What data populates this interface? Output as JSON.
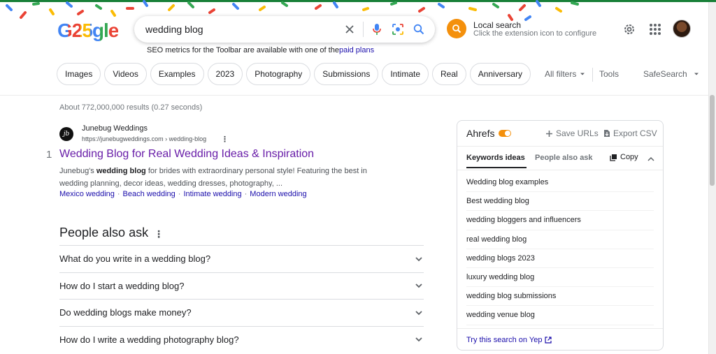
{
  "header": {
    "logo_text": "G25gle",
    "search_query": "wedding blog",
    "local_search": {
      "title": "Local search",
      "subtitle": "Click the extension icon to configure"
    },
    "seo_note": {
      "text": "SEO metrics for the Toolbar are available with one of the",
      "link": "paid plans"
    }
  },
  "chips": [
    "Images",
    "Videos",
    "Examples",
    "2023",
    "Photography",
    "Submissions",
    "Intimate",
    "Real",
    "Anniversary"
  ],
  "tools": {
    "all_filters": "All filters",
    "tools": "Tools",
    "safesearch": "SafeSearch"
  },
  "results": {
    "stats": "About 772,000,000 results (0.27 seconds)",
    "items": [
      {
        "rank": "1",
        "favicon_text": "jb",
        "site_name": "Junebug Weddings",
        "url": "https://junebugweddings.com › wedding-blog",
        "title": "Wedding Blog for Real Wedding Ideas & Inspiration",
        "snippet_pre": "Junebug's ",
        "snippet_bold": "wedding blog",
        "snippet_post": " for brides with extraordinary personal style! Featuring the best in wedding planning, decor ideas, wedding dresses, photography, ...",
        "sitelinks": [
          "Mexico wedding",
          "Beach wedding",
          "Intimate wedding",
          "Modern wedding"
        ]
      }
    ]
  },
  "people_also_ask": {
    "title": "People also ask",
    "questions": [
      "What do you write in a wedding blog?",
      "How do I start a wedding blog?",
      "Do wedding blogs make money?",
      "How do I write a wedding photography blog?"
    ]
  },
  "ahrefs_panel": {
    "brand": "Ahrefs",
    "save_urls": "Save URLs",
    "export_csv": "Export CSV",
    "tabs": [
      "Keywords ideas",
      "People also ask"
    ],
    "copy": "Copy",
    "keywords": [
      "Wedding blog examples",
      "Best wedding blog",
      "wedding bloggers and influencers",
      "real wedding blog",
      "wedding blogs 2023",
      "luxury wedding blog",
      "wedding blog submissions",
      "wedding venue blog"
    ],
    "yep_link": "Try this search on Yep"
  },
  "colors": {
    "accent_orange": "#f4900c",
    "link_blue": "#1a0dab",
    "visited_purple": "#681da8"
  }
}
